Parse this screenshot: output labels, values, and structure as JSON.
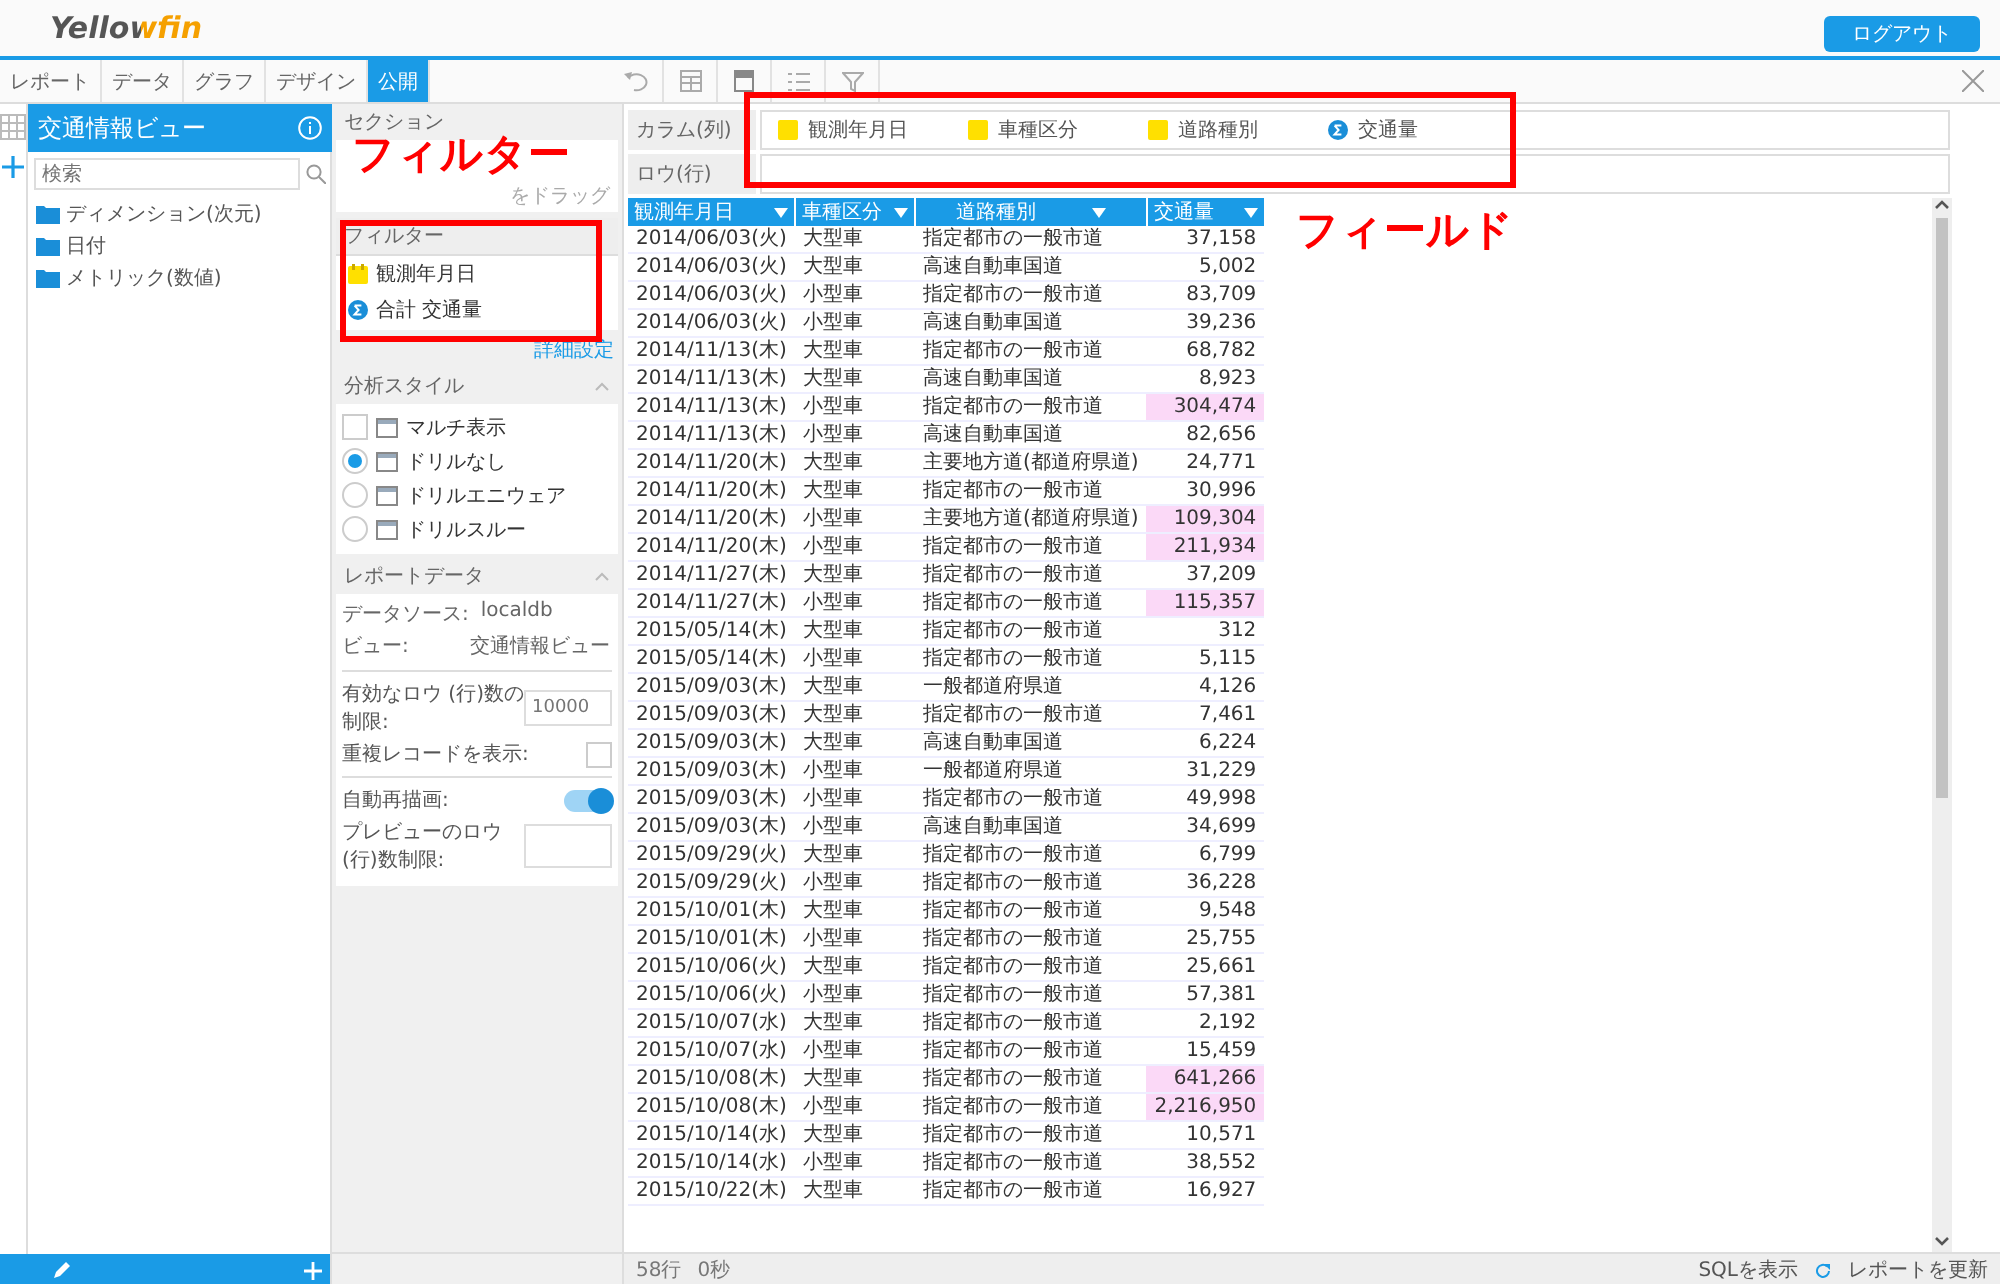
{
  "header": {
    "logo": "Yellowfin",
    "logout_button": "ログアウト"
  },
  "tabs": [
    {
      "label": "レポート",
      "selected": false
    },
    {
      "label": "データ",
      "selected": false
    },
    {
      "label": "グラフ",
      "selected": false
    },
    {
      "label": "デザイン",
      "selected": false
    },
    {
      "label": "公開",
      "selected": true
    }
  ],
  "view_panel": {
    "title": "交通情報ビュー",
    "search": {
      "placeholder": "検索"
    },
    "folders": [
      {
        "label": "ディメンション(次元)"
      },
      {
        "label": "日付"
      },
      {
        "label": "メトリック(数値)"
      }
    ]
  },
  "section_panel": {
    "title": "セクション",
    "drop_hint": "をドラッグ"
  },
  "filter_panel": {
    "title": "フィルター",
    "items": [
      {
        "kind": "date",
        "label": "観測年月日"
      },
      {
        "kind": "metric",
        "label": "合計 交通量"
      }
    ],
    "link": "詳細設定"
  },
  "analysis_style": {
    "title": "分析スタイル",
    "options": [
      {
        "kind": "checkbox",
        "label": "マルチ表示",
        "checked": false
      },
      {
        "kind": "radio",
        "label": "ドリルなし",
        "selected": true
      },
      {
        "kind": "radio",
        "label": "ドリルエニウェア",
        "selected": false
      },
      {
        "kind": "radio",
        "label": "ドリルスルー",
        "selected": false
      }
    ]
  },
  "report_data": {
    "title": "レポートデータ",
    "source_label": "データソース:",
    "source_value": "localdb",
    "view_label": "ビュー:",
    "view_value": "交通情報ビュー",
    "row_limit_label": "有効なロウ (行)数の制限:",
    "row_limit": {
      "placeholder": "10000"
    },
    "duplicates_label": "重複レコードを表示:",
    "duplicates_checked": false,
    "auto_redraw_label": "自動再描画:",
    "auto_redraw_on": true,
    "preview_limit_label": "プレビューのロウ (行)数制限:"
  },
  "columns_zone": {
    "label": "カラム(列)",
    "fields": [
      {
        "kind": "dimension",
        "label": "観測年月日"
      },
      {
        "kind": "dimension",
        "label": "車種区分"
      },
      {
        "kind": "dimension",
        "label": "道路種別"
      },
      {
        "kind": "metric",
        "label": "交通量"
      }
    ]
  },
  "rows_zone": {
    "label": "ロウ(行)"
  },
  "table": {
    "columns": [
      "観測年月日",
      "車種区分",
      "道路種別",
      "交通量"
    ],
    "rows": [
      {
        "date": "2014/06/03(火)",
        "vehicle": "大型車",
        "road": "指定都市の一般市道",
        "volume": "37,158",
        "highlighted": false
      },
      {
        "date": "2014/06/03(火)",
        "vehicle": "大型車",
        "road": "高速自動車国道",
        "volume": "5,002",
        "highlighted": false
      },
      {
        "date": "2014/06/03(火)",
        "vehicle": "小型車",
        "road": "指定都市の一般市道",
        "volume": "83,709",
        "highlighted": false
      },
      {
        "date": "2014/06/03(火)",
        "vehicle": "小型車",
        "road": "高速自動車国道",
        "volume": "39,236",
        "highlighted": false
      },
      {
        "date": "2014/11/13(木)",
        "vehicle": "大型車",
        "road": "指定都市の一般市道",
        "volume": "68,782",
        "highlighted": false
      },
      {
        "date": "2014/11/13(木)",
        "vehicle": "大型車",
        "road": "高速自動車国道",
        "volume": "8,923",
        "highlighted": false
      },
      {
        "date": "2014/11/13(木)",
        "vehicle": "小型車",
        "road": "指定都市の一般市道",
        "volume": "304,474",
        "highlighted": true
      },
      {
        "date": "2014/11/13(木)",
        "vehicle": "小型車",
        "road": "高速自動車国道",
        "volume": "82,656",
        "highlighted": false
      },
      {
        "date": "2014/11/20(木)",
        "vehicle": "大型車",
        "road": "主要地方道(都道府県道)",
        "volume": "24,771",
        "highlighted": false
      },
      {
        "date": "2014/11/20(木)",
        "vehicle": "大型車",
        "road": "指定都市の一般市道",
        "volume": "30,996",
        "highlighted": false
      },
      {
        "date": "2014/11/20(木)",
        "vehicle": "小型車",
        "road": "主要地方道(都道府県道)",
        "volume": "109,304",
        "highlighted": true
      },
      {
        "date": "2014/11/20(木)",
        "vehicle": "小型車",
        "road": "指定都市の一般市道",
        "volume": "211,934",
        "highlighted": true
      },
      {
        "date": "2014/11/27(木)",
        "vehicle": "大型車",
        "road": "指定都市の一般市道",
        "volume": "37,209",
        "highlighted": false
      },
      {
        "date": "2014/11/27(木)",
        "vehicle": "小型車",
        "road": "指定都市の一般市道",
        "volume": "115,357",
        "highlighted": true
      },
      {
        "date": "2015/05/14(木)",
        "vehicle": "大型車",
        "road": "指定都市の一般市道",
        "volume": "312",
        "highlighted": false
      },
      {
        "date": "2015/05/14(木)",
        "vehicle": "小型車",
        "road": "指定都市の一般市道",
        "volume": "5,115",
        "highlighted": false
      },
      {
        "date": "2015/09/03(木)",
        "vehicle": "大型車",
        "road": "一般都道府県道",
        "volume": "4,126",
        "highlighted": false
      },
      {
        "date": "2015/09/03(木)",
        "vehicle": "大型車",
        "road": "指定都市の一般市道",
        "volume": "7,461",
        "highlighted": false
      },
      {
        "date": "2015/09/03(木)",
        "vehicle": "大型車",
        "road": "高速自動車国道",
        "volume": "6,224",
        "highlighted": false
      },
      {
        "date": "2015/09/03(木)",
        "vehicle": "小型車",
        "road": "一般都道府県道",
        "volume": "31,229",
        "highlighted": false
      },
      {
        "date": "2015/09/03(木)",
        "vehicle": "小型車",
        "road": "指定都市の一般市道",
        "volume": "49,998",
        "highlighted": false
      },
      {
        "date": "2015/09/03(木)",
        "vehicle": "小型車",
        "road": "高速自動車国道",
        "volume": "34,699",
        "highlighted": false
      },
      {
        "date": "2015/09/29(火)",
        "vehicle": "大型車",
        "road": "指定都市の一般市道",
        "volume": "6,799",
        "highlighted": false
      },
      {
        "date": "2015/09/29(火)",
        "vehicle": "小型車",
        "road": "指定都市の一般市道",
        "volume": "36,228",
        "highlighted": false
      },
      {
        "date": "2015/10/01(木)",
        "vehicle": "大型車",
        "road": "指定都市の一般市道",
        "volume": "9,548",
        "highlighted": false
      },
      {
        "date": "2015/10/01(木)",
        "vehicle": "小型車",
        "road": "指定都市の一般市道",
        "volume": "25,755",
        "highlighted": false
      },
      {
        "date": "2015/10/06(火)",
        "vehicle": "大型車",
        "road": "指定都市の一般市道",
        "volume": "25,661",
        "highlighted": false
      },
      {
        "date": "2015/10/06(火)",
        "vehicle": "小型車",
        "road": "指定都市の一般市道",
        "volume": "57,381",
        "highlighted": false
      },
      {
        "date": "2015/10/07(水)",
        "vehicle": "大型車",
        "road": "指定都市の一般市道",
        "volume": "2,192",
        "highlighted": false
      },
      {
        "date": "2015/10/07(水)",
        "vehicle": "小型車",
        "road": "指定都市の一般市道",
        "volume": "15,459",
        "highlighted": false
      },
      {
        "date": "2015/10/08(木)",
        "vehicle": "大型車",
        "road": "指定都市の一般市道",
        "volume": "641,266",
        "highlighted": true
      },
      {
        "date": "2015/10/08(木)",
        "vehicle": "小型車",
        "road": "指定都市の一般市道",
        "volume": "2,216,950",
        "highlighted": true
      },
      {
        "date": "2015/10/14(水)",
        "vehicle": "大型車",
        "road": "指定都市の一般市道",
        "volume": "10,571",
        "highlighted": false
      },
      {
        "date": "2015/10/14(水)",
        "vehicle": "小型車",
        "road": "指定都市の一般市道",
        "volume": "38,552",
        "highlighted": false
      },
      {
        "date": "2015/10/22(木)",
        "vehicle": "大型車",
        "road": "指定都市の一般市道",
        "volume": "16,927",
        "highlighted": false
      }
    ]
  },
  "status_bar": {
    "rows": "58行",
    "time": "0秒",
    "sql_link": "SQLを表示",
    "refresh_link": "レポートを更新"
  },
  "callouts": {
    "filter": {
      "label": "フィルター"
    },
    "fields": {
      "label": "フィールド"
    }
  }
}
